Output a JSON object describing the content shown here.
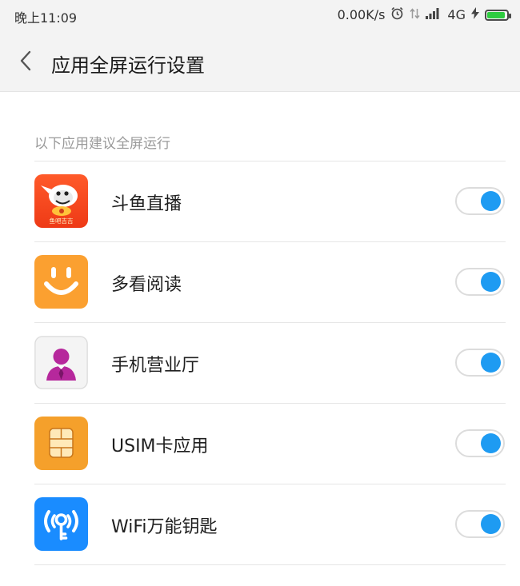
{
  "status_bar": {
    "time": "晚上11:09",
    "network_speed": "0.00K/s",
    "network_type": "4G",
    "icons": [
      "alarm-icon",
      "data-arrows-icon",
      "signal-icon",
      "charging-bolt-icon",
      "battery-icon"
    ],
    "battery_color": "#2ecc40"
  },
  "header": {
    "back_icon": "chevron-left-icon",
    "title": "应用全屏运行设置"
  },
  "section": {
    "label": "以下应用建议全屏运行"
  },
  "apps": [
    {
      "name": "斗鱼直播",
      "icon": "douyu-app-icon",
      "icon_text": "鱼吧吉吉",
      "enabled": true
    },
    {
      "name": "多看阅读",
      "icon": "duokan-app-icon",
      "enabled": true
    },
    {
      "name": "手机营业厅",
      "icon": "mobile-hall-app-icon",
      "enabled": true
    },
    {
      "name": "USIM卡应用",
      "icon": "usim-app-icon",
      "enabled": true
    },
    {
      "name": "WiFi万能钥匙",
      "icon": "wifi-key-app-icon",
      "enabled": true
    }
  ],
  "colors": {
    "toggle_on": "#1e9bf2",
    "header_bg": "#f3f3f3"
  }
}
